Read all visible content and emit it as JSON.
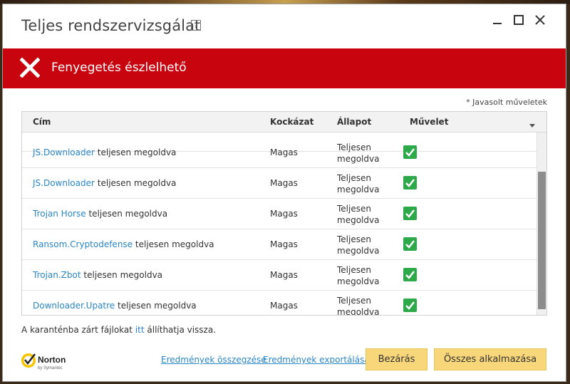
{
  "window": {
    "title": "Teljes rendszervizsgálat",
    "help_label": "?"
  },
  "banner": {
    "text": "Fenyegetés észlelhető",
    "color": "#c8040e"
  },
  "recommended_note": "* Javasolt műveletek",
  "table": {
    "headers": {
      "title": "Cím",
      "risk": "Kockázat",
      "status": "Állapot",
      "action": "Művelet"
    },
    "rows": [
      {
        "name": "JS.Downloader",
        "suffix": "teljesen megoldva",
        "risk": "Magas",
        "status_line1": "Teljesen",
        "status_line2": "megoldva"
      },
      {
        "name": "JS.Downloader",
        "suffix": "teljesen megoldva",
        "risk": "Magas",
        "status_line1": "Teljesen",
        "status_line2": "megoldva"
      },
      {
        "name": "Trojan Horse",
        "suffix": "teljesen megoldva",
        "risk": "Magas",
        "status_line1": "Teljesen",
        "status_line2": "megoldva"
      },
      {
        "name": "Ransom.Cryptodefense",
        "suffix": "teljesen megoldva",
        "risk": "Magas",
        "status_line1": "Teljesen",
        "status_line2": "megoldva"
      },
      {
        "name": "Trojan.Zbot",
        "suffix": "teljesen megoldva",
        "risk": "Magas",
        "status_line1": "Teljesen",
        "status_line2": "megoldva"
      },
      {
        "name": "Downloader.Upatre",
        "suffix": "teljesen megoldva",
        "risk": "Magas",
        "status_line1": "Teljesen",
        "status_line2": "megoldva"
      }
    ]
  },
  "restore_note": {
    "before": "A karanténba zárt fájlokat",
    "link": "itt",
    "after": "állíthatja vissza."
  },
  "footer": {
    "logo_name": "Norton",
    "logo_sub": "by Symantec",
    "summary_link": "Eredmények összegzése",
    "export_link": "Eredmények exportálása",
    "close_button": "Bezárás",
    "apply_all_button": "Összes alkalmazása"
  }
}
